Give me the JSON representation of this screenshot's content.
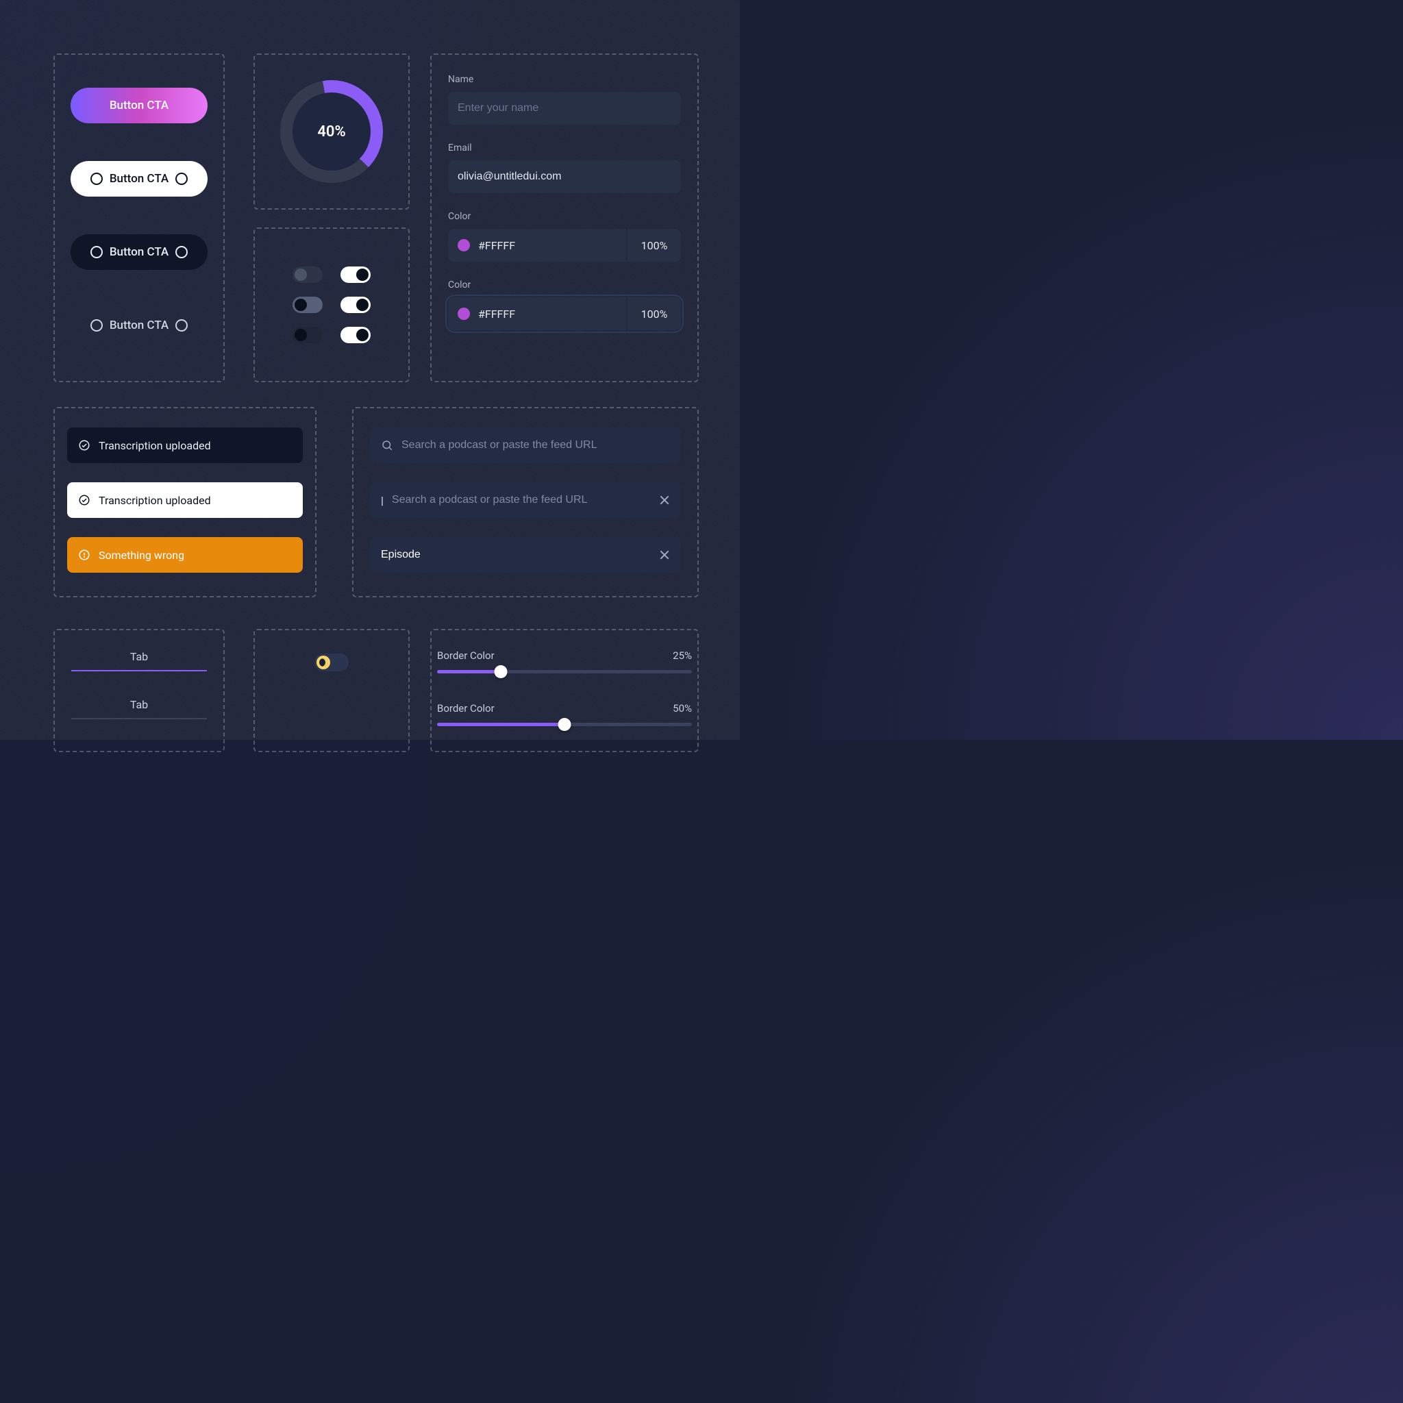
{
  "buttons": {
    "gradient": "Button CTA",
    "white": "Button CTA",
    "dark": "Button CTA",
    "ghost": "Button CTA"
  },
  "donut": {
    "pct_label": "40%",
    "pct_value": 40
  },
  "form": {
    "name_label": "Name",
    "name_placeholder": "Enter your name",
    "email_label": "Email",
    "email_value": "olivia@untitledui.com",
    "color1_label": "Color",
    "color1_value": "#FFFFF",
    "color1_pct": "100%",
    "color1_swatch": "#b24dd8",
    "color2_label": "Color",
    "color2_value": "#FFFFF",
    "color2_pct": "100%",
    "color2_swatch": "#b24dd8"
  },
  "toasts": {
    "ok1": "Transcription uploaded",
    "ok2": "Transcription uploaded",
    "warn": "Something wrong"
  },
  "search": {
    "placeholder": "Search a podcast or paste the feed URL",
    "active_placeholder": "Search a podcast or paste the feed URL",
    "typed_value": "Episode"
  },
  "tabs": {
    "tab1": "Tab",
    "tab2": "Tab"
  },
  "sliders": {
    "s1_label": "Border Color",
    "s1_pct": "25%",
    "s1_value": 25,
    "s2_label": "Border Color",
    "s2_pct": "50%",
    "s2_value": 50
  }
}
